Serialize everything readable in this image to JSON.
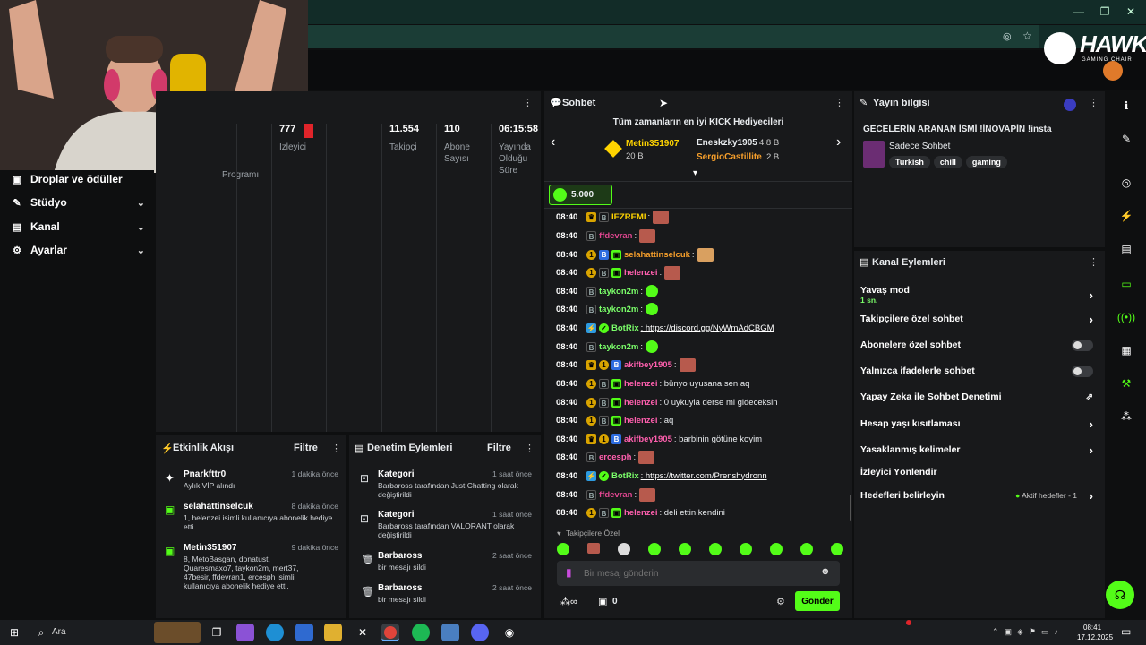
{
  "browser": {
    "minimize": "—",
    "restore": "❐",
    "close": "✕"
  },
  "brand": {
    "logo": "HAWK",
    "sub": "GAMING CHAIR"
  },
  "sidebar": {
    "items": [
      {
        "label": "Droplar ve ödüller",
        "icon": "gift-icon"
      },
      {
        "label": "Stüdyo",
        "icon": "brush-icon"
      },
      {
        "label": "Kanal",
        "icon": "channel-icon"
      },
      {
        "label": "Ayarlar",
        "icon": "gear-icon"
      }
    ],
    "program_label": "Programı"
  },
  "stats": [
    {
      "value": "777",
      "label": "İzleyici"
    },
    {
      "value": "11.554",
      "label": "Takipçi"
    },
    {
      "value": "110",
      "label": "Abone Sayısı"
    },
    {
      "value": "06:15:58",
      "label": "Yayında Olduğu Süre"
    }
  ],
  "chat": {
    "title": "Sohbet",
    "gifters_title": "Tüm zamanların en iyi KICK Hediyecileri",
    "gifters": [
      {
        "name": "Metin351907",
        "amount": "20 B"
      },
      {
        "name": "Eneskzky1905",
        "amount": "4,8 B"
      },
      {
        "name": "SergioCastillite",
        "amount": "2 B"
      }
    ],
    "goal": "5.000",
    "messages": [
      {
        "time": "08:40",
        "user": "IEZREMI",
        "text": ":"
      },
      {
        "time": "08:40",
        "user": "ffdevran",
        "text": ":"
      },
      {
        "time": "08:40",
        "user": "selahattinselcuk",
        "text": ":"
      },
      {
        "time": "08:40",
        "user": "helenzei",
        "text": ":"
      },
      {
        "time": "08:40",
        "user": "taykon2m",
        "text": ":"
      },
      {
        "time": "08:40",
        "user": "taykon2m",
        "text": ":"
      },
      {
        "time": "08:40",
        "user": "BotRix",
        "text": ": https://discord.gg/NyWmAdCBGM"
      },
      {
        "time": "08:40",
        "user": "taykon2m",
        "text": ":"
      },
      {
        "time": "08:40",
        "user": "akifbey1905",
        "text": ":"
      },
      {
        "time": "08:40",
        "user": "helenzei",
        "text": ": bünyo uyusana sen aq"
      },
      {
        "time": "08:40",
        "user": "helenzei",
        "text": ": 0 uykuyla derse mi gideceksin"
      },
      {
        "time": "08:40",
        "user": "helenzei",
        "text": ": aq"
      },
      {
        "time": "08:40",
        "user": "akifbey1905",
        "text": ": barbinin götüne koyim"
      },
      {
        "time": "08:40",
        "user": "ercesph",
        "text": ":"
      },
      {
        "time": "08:40",
        "user": "BotRix",
        "text": ": https://twitter.com/Prenshydronn"
      },
      {
        "time": "08:40",
        "user": "ffdevran",
        "text": ":"
      },
      {
        "time": "08:40",
        "user": "helenzei",
        "text": ": deli ettin kendini"
      }
    ],
    "followers_only_label": "Takipçilere Özel",
    "input_placeholder": "Bir mesaj gönderin",
    "count": "0",
    "send": "Gönder"
  },
  "stream_info": {
    "header": "Yayın bilgisi",
    "title": "GECELERİN ARANAN İSMİ !İNOVAPİN !insta",
    "category": "Sadece Sohbet",
    "tags": [
      "Turkish",
      "chill",
      "gaming"
    ]
  },
  "channel_actions": {
    "header": "Kanal Eylemleri",
    "slow_mode": "Yavaş mod",
    "slow_mode_value": "1 sn.",
    "items": [
      "Takipçilere özel sohbet",
      "Abonelere özel sohbet",
      "Yalnızca ifadelerle sohbet",
      "Yapay Zeka ile Sohbet Denetimi",
      "Hesap yaşı kısıtlaması",
      "Yasaklanmış kelimeler",
      "İzleyici Yönlendir",
      "Hedefleri belirleyin"
    ],
    "goals_status": "Aktif hedefler - 1"
  },
  "activity": {
    "header": "Etkinlik Akışı",
    "filter": "Filtre",
    "items": [
      {
        "name": "Pnarkfttr0",
        "time": "1 dakika önce",
        "desc": "Aylık VİP alındı"
      },
      {
        "name": "selahattinselcuk",
        "time": "8 dakika önce",
        "desc": "1, helenzei isimli kullanıcıya abonelik hediye etti."
      },
      {
        "name": "Metin351907",
        "time": "9 dakika önce",
        "desc": "8, MetoBasgan, donatust, Quaresmaxo7, taykon2m, mert37, 47besir, ffdevran1, ercesph isimli kullanıcıya abonelik hediye etti."
      }
    ]
  },
  "mod": {
    "header": "Denetim Eylemleri",
    "filter": "Filtre",
    "items": [
      {
        "name": "Kategori",
        "time": "1 saat önce",
        "desc": "Barbaross tarafından Just Chatting olarak değiştirildi"
      },
      {
        "name": "Kategori",
        "time": "1 saat önce",
        "desc": "Barbaross tarafından VALORANT olarak değiştirildi"
      },
      {
        "name": "Barbaross",
        "time": "2 saat önce",
        "desc": "bir mesajı sildi"
      },
      {
        "name": "Barbaross",
        "time": "2 saat önce",
        "desc": "bir mesajı sildi"
      }
    ]
  },
  "taskbar": {
    "search": "Ara",
    "time": "08:41",
    "date": "17.12.2025"
  },
  "colors": {
    "kick_green": "#53fc18",
    "panel": "#18191b"
  }
}
